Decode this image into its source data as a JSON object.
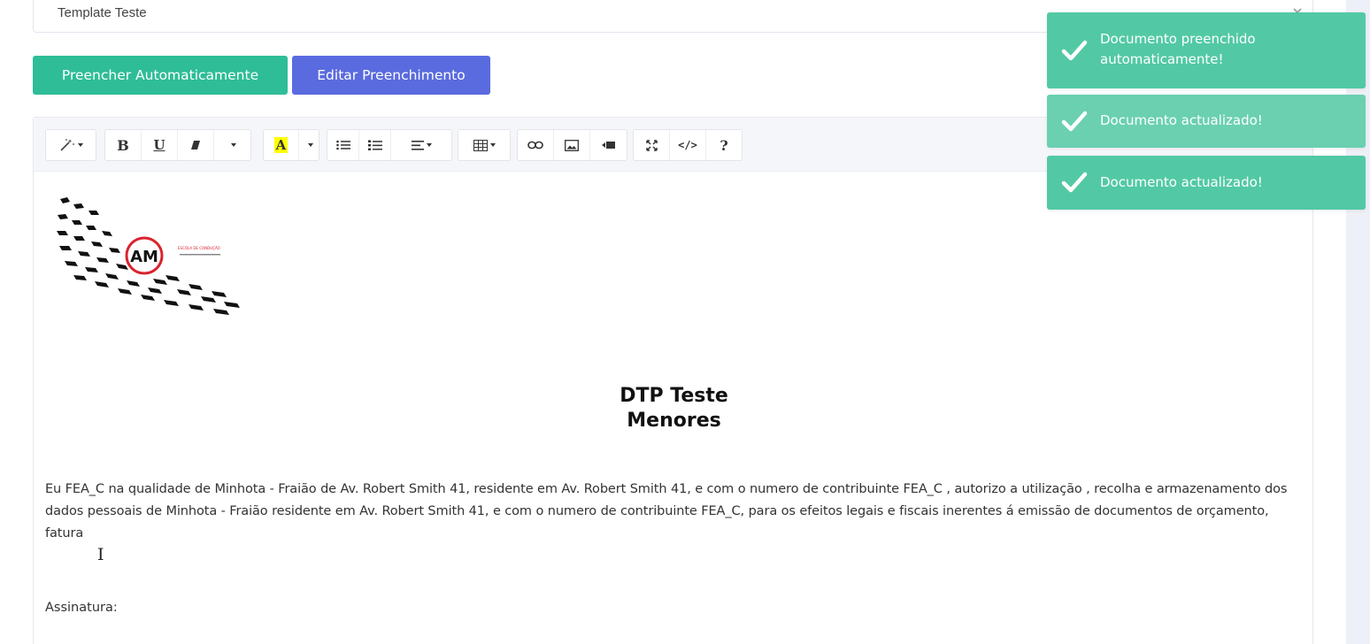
{
  "template_select": {
    "value": "Template Teste"
  },
  "actions": {
    "autofill_label": "Preencher Automaticamente",
    "edit_label": "Editar Preenchimento"
  },
  "toolbar": {
    "bold": "B",
    "underline": "U",
    "highlight": "A",
    "help": "?",
    "code": "</>"
  },
  "document": {
    "title_line1": "DTP Teste",
    "title_line2": "Menores",
    "body": "Eu FEA_C na qualidade de Minhota - Fraião de Av. Robert Smith 41, residente em Av. Robert Smith 41, e com o numero de contribuinte FEA_C , autorizo a utilização , recolha e armazenamento dos dados pessoais de Minhota - Fraião residente em Av. Robert Smith 41, e com o numero de contribuinte FEA_C, para os efeitos legais e fiscais inerentes á emissão de documentos de orçamento, fatura",
    "signature_label": "Assinatura:"
  },
  "logo": {
    "monogram": "AM",
    "tagline": "ESCOLA DE CONDUÇÃO"
  },
  "notifications": [
    {
      "message": "Documento preenchido automaticamente!"
    },
    {
      "message": "Documento actualizado!"
    },
    {
      "message": "Documento actualizado!"
    }
  ],
  "colors": {
    "primary_green": "#2ebd97",
    "primary_indigo": "#5a6bdf",
    "toast_green": "#52c9a4",
    "logo_red": "#d9232e"
  }
}
